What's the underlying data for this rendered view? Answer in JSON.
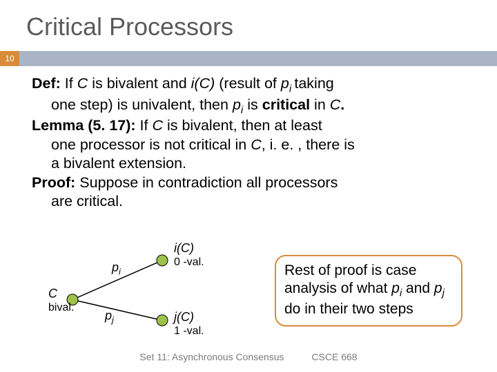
{
  "title": "Critical Processors",
  "page_number": "10",
  "def_label": "Def:",
  "def_line1a": " If ",
  "def_C": "C",
  "def_line1b": " is bivalent and ",
  "def_iC": "i(C)",
  "def_line1c": " (result of ",
  "def_pi": "p",
  "def_pi_sub": "i ",
  "def_line1d": "taking",
  "def_line2a": "one step) is univalent, then ",
  "def_pi2": "p",
  "def_pi2_sub": "i",
  "def_line2b": " is ",
  "def_critical": "critical",
  "def_line2c": " in ",
  "def_C2": "C",
  "def_period": ".",
  "lemma_label": "Lemma (5. 17):",
  "lemma_1a": "  If ",
  "lemma_C": "C",
  "lemma_1b": " is bivalent, then at least",
  "lemma_2": "one processor is not critical in ",
  "lemma_C2": "C",
  "lemma_2b": ", i. e. , there is",
  "lemma_3": "a bivalent extension.",
  "proof_label": "Proof:",
  "proof_1": "  Suppose in contradiction all processors",
  "proof_2": "are critical.",
  "diagram": {
    "c": "C",
    "bival": "bival.",
    "pi": "p",
    "pi_sub": "i",
    "pj": "p",
    "pj_sub": "j",
    "iC": "i(C)",
    "zeroval": "0 -val.",
    "jC": "j(C)",
    "oneval": "1 -val."
  },
  "callout_1": "Rest of proof is case analysis of what ",
  "callout_pi": "p",
  "callout_pi_sub": "i",
  "callout_2": " and ",
  "callout_pj": "p",
  "callout_pj_sub": "j",
  "callout_3": " do in their two steps",
  "footer_left": "Set 11: Asynchronous Consensus",
  "footer_right": "CSCE 668"
}
